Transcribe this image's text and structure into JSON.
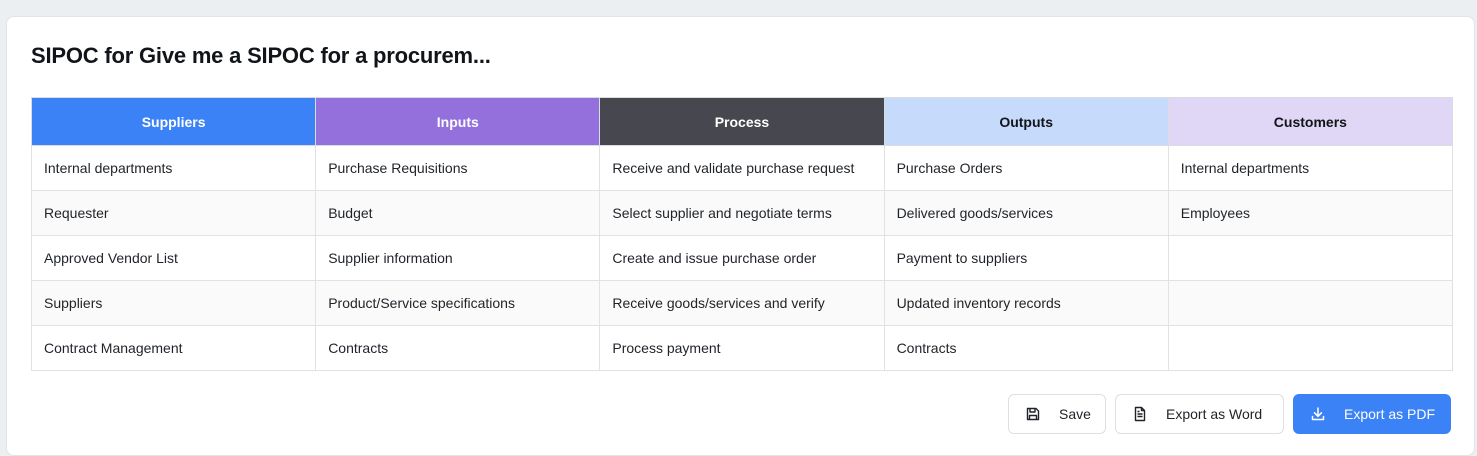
{
  "title": "SIPOC for Give me a SIPOC for a procurem...",
  "table": {
    "headers": [
      {
        "label": "Suppliers",
        "bg": "#3b82f6",
        "color": "#ffffff"
      },
      {
        "label": "Inputs",
        "bg": "#9370db",
        "color": "#ffffff"
      },
      {
        "label": "Process",
        "bg": "#47474f",
        "color": "#ffffff"
      },
      {
        "label": "Outputs",
        "bg": "#c6dafc",
        "color": "#111418"
      },
      {
        "label": "Customers",
        "bg": "#e0d6f5",
        "color": "#111418"
      }
    ],
    "rows": [
      [
        "Internal departments",
        "Purchase Requisitions",
        "Receive and validate purchase request",
        "Purchase Orders",
        "Internal departments"
      ],
      [
        "Requester",
        "Budget",
        "Select supplier and negotiate terms",
        "Delivered goods/services",
        "Employees"
      ],
      [
        "Approved Vendor List",
        "Supplier information",
        "Create and issue purchase order",
        "Payment to suppliers",
        ""
      ],
      [
        "Suppliers",
        "Product/Service specifications",
        "Receive goods/services and verify",
        "Updated inventory records",
        ""
      ],
      [
        "Contract Management",
        "Contracts",
        "Process payment",
        "Contracts",
        ""
      ]
    ]
  },
  "actions": {
    "save_label": "Save",
    "save_icon": "save-icon",
    "word_label": "Export as Word",
    "word_icon": "document-icon",
    "pdf_label": "Export as PDF",
    "pdf_icon": "download-icon",
    "accent": "#3b82f6"
  }
}
